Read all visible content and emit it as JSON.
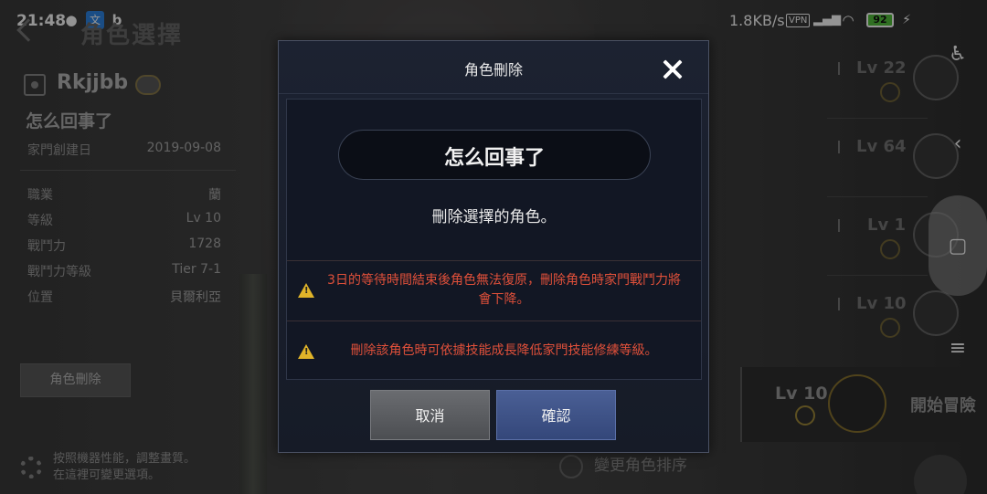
{
  "status_bar": {
    "time": "21:48",
    "speed": "1.8KB/s",
    "vpn": "VPN",
    "battery": "92"
  },
  "screen": {
    "title": "角色選擇"
  },
  "family": {
    "name": "Rkjjbb",
    "char_name": "怎么回事了",
    "created_label": "家門創建日",
    "created_date": "2019-09-08"
  },
  "stats": [
    {
      "label": "職業",
      "value": "蘭"
    },
    {
      "label": "等級",
      "value": "Lv 10"
    },
    {
      "label": "戰鬥力",
      "value": "1728"
    },
    {
      "label": "戰鬥力等級",
      "value": "Tier 7-1"
    },
    {
      "label": "位置",
      "value": "貝爾利亞"
    }
  ],
  "left_actions": {
    "delete_button": "角色刪除",
    "settings_text_1": "按照機器性能，調整畫質。",
    "settings_text_2": "在這裡可變更選項。",
    "reorder": "變更角色排序"
  },
  "char_list": [
    {
      "level": "Lv 22"
    },
    {
      "level": "Lv 64"
    },
    {
      "level": "Lv 1"
    },
    {
      "level": "Lv 10"
    }
  ],
  "active_char": {
    "level": "Lv 10",
    "start_label": "開始冒險"
  },
  "dialog": {
    "title": "角色刪除",
    "character_name": "怎么回事了",
    "message": "刪除選擇的角色。",
    "warning_1": "3日的等待時間結束後角色無法復原，刪除角色時家門戰鬥力將會下降。",
    "warning_2": "刪除該角色時可依據技能成長降低家門技能修練等級。",
    "cancel_label": "取消",
    "confirm_label": "確認"
  },
  "colors": {
    "warning_text": "#e0503a",
    "warning_icon": "#e0b429",
    "confirm_button": "#3f5388",
    "cancel_button": "#5c5e62",
    "battery": "#53c23b"
  },
  "icons": [
    "accessibility-icon",
    "chevron-left-icon",
    "square-icon",
    "menu-icon",
    "close-icon",
    "warning-icon",
    "gear-icon"
  ]
}
